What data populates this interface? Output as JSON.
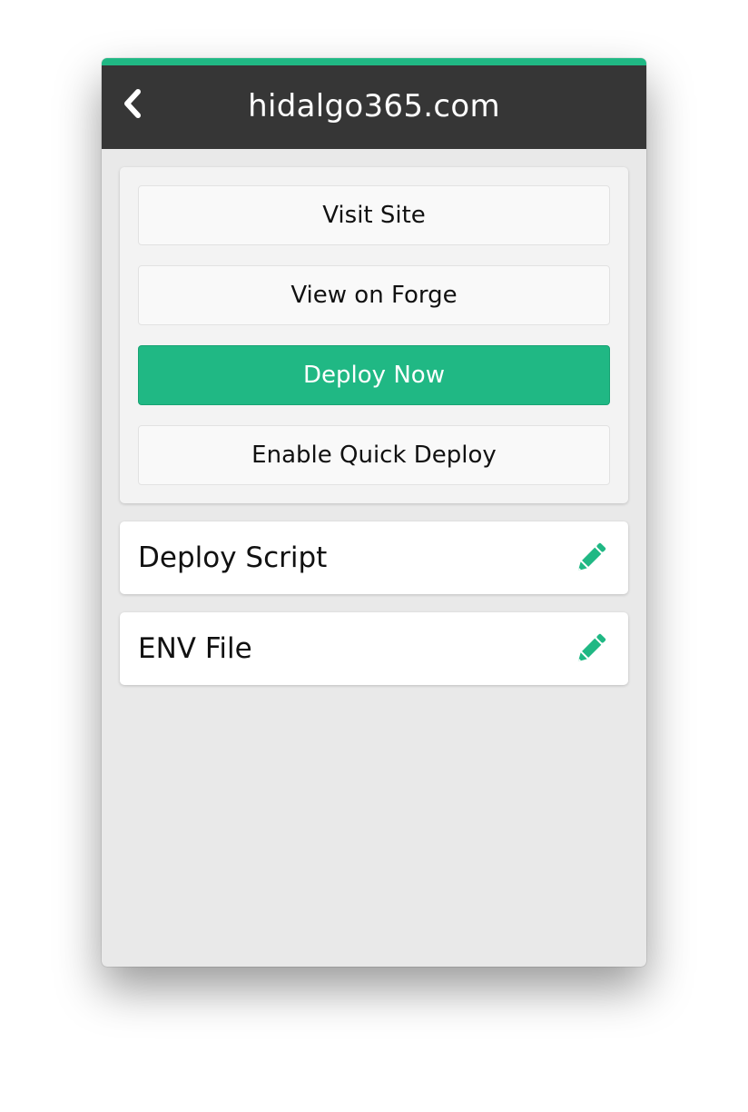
{
  "colors": {
    "accent": "#20b884",
    "header_bg": "#363636",
    "body_bg": "#e9e9e9"
  },
  "header": {
    "back_icon": "chevron-left-icon",
    "title": "hidalgo365.com"
  },
  "actions": {
    "visit_site": "Visit Site",
    "view_on_forge": "View on Forge",
    "deploy_now": "Deploy Now",
    "enable_quick_deploy": "Enable Quick Deploy"
  },
  "items": [
    {
      "label": "Deploy Script",
      "icon": "pencil-icon"
    },
    {
      "label": "ENV File",
      "icon": "pencil-icon"
    }
  ]
}
